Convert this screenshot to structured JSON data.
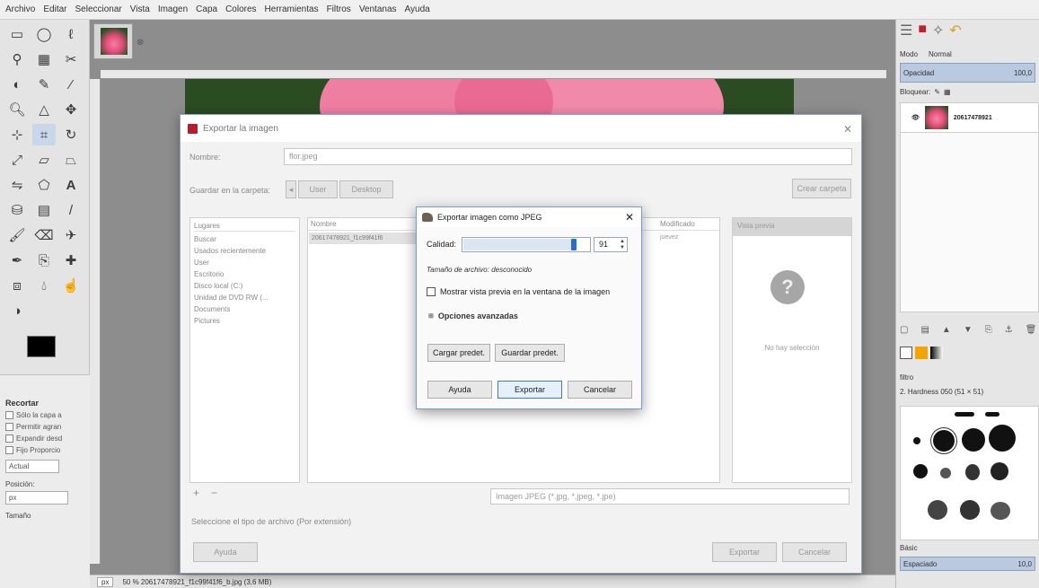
{
  "menubar": [
    "Archivo",
    "Editar",
    "Seleccionar",
    "Vista",
    "Imagen",
    "Capa",
    "Colores",
    "Herramientas",
    "Filtros",
    "Ventanas",
    "Ayuda"
  ],
  "tool_options": {
    "title": "Recortar",
    "options": [
      "Sólo la capa a",
      "Permitir agran",
      "Expandir desd",
      "Fijo Proporcio"
    ],
    "dropdown": "Actual",
    "position_label": "Posición:",
    "position_value": "px",
    "size_label": "Tamaño"
  },
  "status": {
    "unit": "px",
    "text": "50 % 20617478921_f1c99f41f6_b.jpg (3,6 MB)"
  },
  "right_dock": {
    "mode_label": "Modo",
    "mode_value": "Normal",
    "opacity_label": "Opacidad",
    "opacity_value": "100,0",
    "lock_label": "Bloquear:",
    "layer_name": "20617478921",
    "brush_filter": "filtro",
    "brush_name": "2. Hardness 050 (51 × 51)",
    "preset_label": "Básic",
    "spacing_label": "Espaciado",
    "spacing_value": "10,0"
  },
  "export_dialog": {
    "title": "Exportar la imagen",
    "name_label": "Nombre:",
    "name_value": "flor.jpeg",
    "folder_label": "Guardar en la carpeta:",
    "path": [
      "User",
      "Desktop"
    ],
    "create_folder": "Crear carpeta",
    "places_header": "Lugares",
    "places": [
      "Buscar",
      "Usados recientemente",
      "User",
      "Escritorio",
      "Disco local (C:)",
      "Unidad de DVD RW (...",
      "Documents",
      "Pictures"
    ],
    "col_name": "Nombre",
    "col_modified": "Modificado",
    "file_name": "20617478921_f1c99f41f6",
    "file_modified": "juevez",
    "preview_header": "Vista previa",
    "no_selection": "No hay selección",
    "filter": "Imagen JPEG (*.jpg, *.jpeg, *.jpe)",
    "select_type": "Seleccione el tipo de archivo (Por extensión)",
    "help": "Ayuda",
    "export": "Exportar",
    "cancel": "Cancelar"
  },
  "jpeg_dialog": {
    "title": "Exportar imagen como JPEG",
    "quality_label": "Calidad:",
    "quality_value": "91",
    "quality_fraction": 0.91,
    "size_text": "Tamaño de archivo: desconocido",
    "preview_check": "Mostrar vista previa en la ventana de la imagen",
    "advanced": "Opciones avanzadas",
    "load_defaults": "Cargar predet.",
    "save_defaults": "Guardar predet.",
    "help": "Ayuda",
    "export": "Exportar",
    "cancel": "Cancelar"
  }
}
